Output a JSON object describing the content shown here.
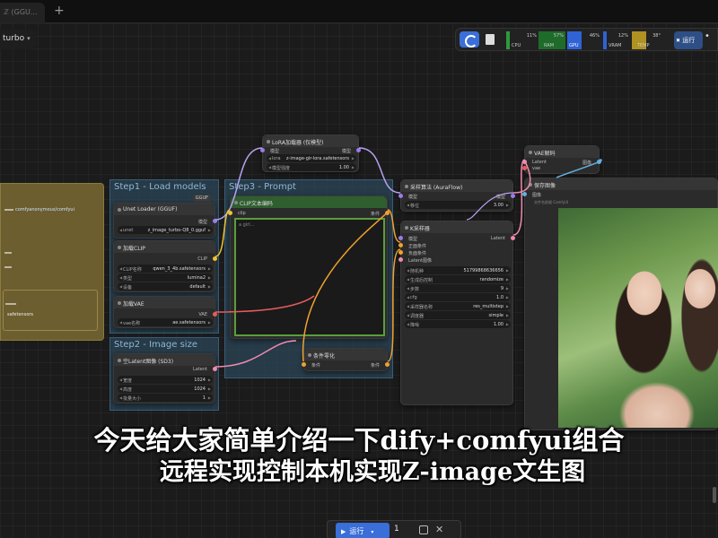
{
  "tabbar": {
    "tab_label": "ℤ (GGU...",
    "add_label": "+"
  },
  "workflow": {
    "name": "turbo"
  },
  "toolbar": {
    "stats": [
      {
        "pct": "11%",
        "label": "CPU",
        "color": "#2d9b3a"
      },
      {
        "pct": "57%",
        "label": "RAM",
        "color": "#2d9b3a"
      },
      {
        "pct": "46%",
        "label": "GPU",
        "color": "#2f63d6"
      },
      {
        "pct": "12%",
        "label": "VRAM",
        "color": "#2f63d6"
      },
      {
        "pct": "38°",
        "label": "TEMP",
        "color": "#b09222"
      }
    ],
    "run_label": "运行",
    "menu_icon": "•"
  },
  "groups": {
    "step1": "Step1 - Load models",
    "step2": "Step2 - Image size",
    "step3": "Step3 - Prompt"
  },
  "nodes": {
    "unet": {
      "title": "Unet Loader (GGUF)",
      "badge": "GGUF",
      "out": "模型",
      "widget_label": "unet",
      "widget_value": "z_image_turbo-Q8_0.gguf"
    },
    "clip": {
      "title": "加载CLIP",
      "out": "CLIP",
      "w1_label": "CLIP名称",
      "w1_value": "qwen_3_4b.safetensors",
      "w2_label": "类型",
      "w2_value": "lumina2",
      "w3_label": "设备",
      "w3_value": "default"
    },
    "vae": {
      "title": "加载VAE",
      "out": "VAE",
      "w1_label": "vae名称",
      "w1_value": "ae.safetensors"
    },
    "latent": {
      "title": "空Latent图像 (SD3)",
      "out": "Latent",
      "w1_label": "宽度",
      "w1_value": "1024",
      "w2_label": "高度",
      "w2_value": "1024",
      "w3_label": "批量大小",
      "w3_value": "1"
    },
    "lora": {
      "title": "LoRA加载器 (仅模型)",
      "in": "模型",
      "out": "模型",
      "w1_label": "lora",
      "w1_value": "z-image-gir-lora.safetensors",
      "w2_label": "模型强度",
      "w2_value": "1.00"
    },
    "prompt": {
      "title": "CLIP文本编码",
      "in": "clip",
      "out": "条件",
      "text": "a girl..."
    },
    "zero": {
      "title": "条件零化",
      "in": "条件",
      "out": "条件"
    },
    "aura": {
      "title": "采样算法 (AuraFlow)",
      "in": "模型",
      "out": "模型",
      "w1_label": "移位",
      "w1_value": "3.00"
    },
    "ksampler": {
      "title": "K采样器",
      "in1": "模型",
      "in2": "正面条件",
      "in3": "负面条件",
      "in4": "Latent图像",
      "out": "Latent",
      "seed_label": "随机种",
      "seed_value": "51799868636656",
      "ctrl_label": "生成后控制",
      "ctrl_value": "randomize",
      "steps_label": "步数",
      "steps_value": "9",
      "cfg_label": "cfg",
      "cfg_value": "1.0",
      "sampler_label": "采样器名称",
      "sampler_value": "res_multistep",
      "sched_label": "调度器",
      "sched_value": "simple",
      "denoise_label": "降噪",
      "denoise_value": "1.00"
    },
    "vaedecode": {
      "title": "VAE解码",
      "in1": "Latent",
      "in2": "vae",
      "out": "图像"
    },
    "save": {
      "title": "保存图像",
      "in": "图像",
      "prefix": "文件名前缀",
      "prefix_value": "ComfyUI"
    }
  },
  "note": {
    "url_text": "comfyanonymous/comfyui",
    "line2": "safetensors"
  },
  "subtitle": {
    "line1": "今天给大家简单介绍一下dify+comfyui组合",
    "line2": "远程实现控制本机实现Z-image文生图"
  },
  "bottom": {
    "run_label": "运行",
    "count": "1",
    "clear": "✕"
  }
}
